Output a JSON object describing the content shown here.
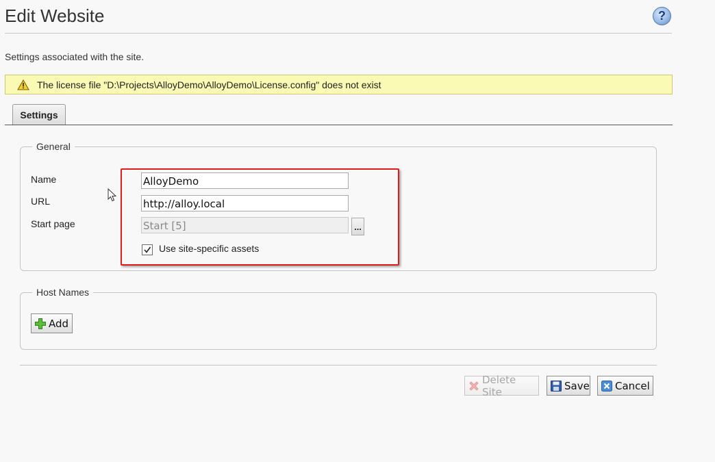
{
  "header": {
    "title": "Edit Website",
    "help_icon": "question-mark-icon",
    "help_symbol": "?"
  },
  "description": "Settings associated with the site.",
  "warning": {
    "icon": "warning-triangle-icon",
    "text": "The license file \"D:\\Projects\\AlloyDemo\\AlloyDemo\\License.config\" does not exist"
  },
  "tabs": [
    {
      "label": "Settings",
      "active": true
    }
  ],
  "general": {
    "legend": "General",
    "name_label": "Name",
    "name_value": "AlloyDemo",
    "url_label": "URL",
    "url_value": "http://alloy.local",
    "start_page_label": "Start page",
    "start_page_value": "Start [5]",
    "browse_label": "...",
    "site_assets_label": "Use site-specific assets",
    "site_assets_checked": true
  },
  "host_names": {
    "legend": "Host Names",
    "add_label": "Add"
  },
  "actions": {
    "delete_label": "Delete Site",
    "delete_disabled": true,
    "save_label": "Save",
    "cancel_label": "Cancel"
  },
  "colors": {
    "warning_bg": "#fafab4",
    "highlight_border": "#e01b1b",
    "help_blue": "#5d86c2"
  }
}
